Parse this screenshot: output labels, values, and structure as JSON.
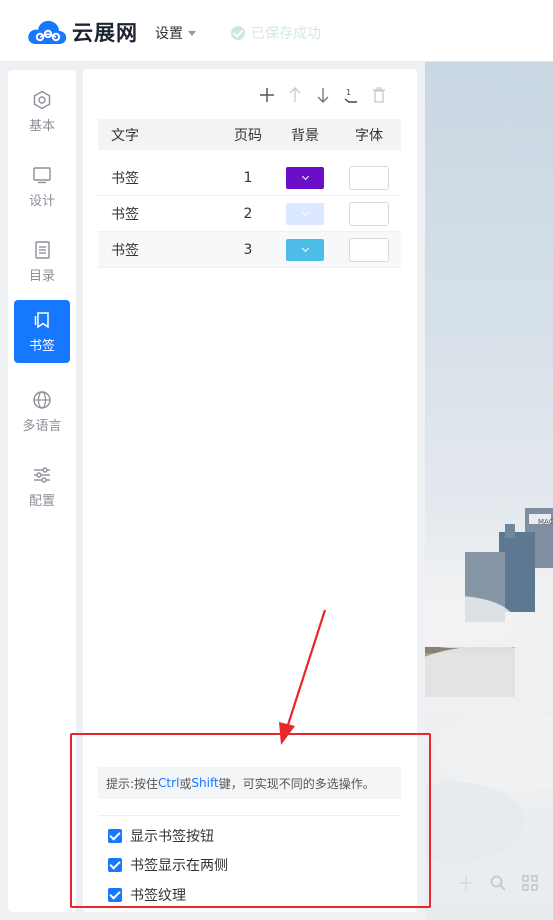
{
  "header": {
    "brand": "云展网",
    "settings_label": "设置",
    "save_status": "已保存成功"
  },
  "sidebar": {
    "items": [
      {
        "label": "基本",
        "icon": "hexagon-settings-icon"
      },
      {
        "label": "设计",
        "icon": "monitor-icon"
      },
      {
        "label": "目录",
        "icon": "document-list-icon"
      },
      {
        "label": "书签",
        "icon": "bookmark-icon",
        "active": true
      },
      {
        "label": "多语言",
        "icon": "globe-icon"
      },
      {
        "label": "配置",
        "icon": "sliders-icon"
      }
    ]
  },
  "toolbar": {
    "icons": [
      "add-icon",
      "move-up-icon",
      "move-down-icon",
      "sort-icon",
      "delete-icon"
    ]
  },
  "table": {
    "headers": {
      "text": "文字",
      "page": "页码",
      "bg": "背景",
      "font": "字体"
    },
    "rows": [
      {
        "text": "书签",
        "page": "1",
        "bg_color": "#6a0fc9"
      },
      {
        "text": "书签",
        "page": "2",
        "bg_color": "#dce8ff"
      },
      {
        "text": "书签",
        "page": "3",
        "bg_color": "#4cbde6"
      }
    ]
  },
  "hint": {
    "prefix": "提示:按住 ",
    "key1": "Ctrl",
    "mid": " 或 ",
    "key2": "Shift",
    "suffix": " 键，可实现不同的多选操作。"
  },
  "options": [
    {
      "label": "显示书签按钮",
      "checked": true
    },
    {
      "label": "书签显示在两侧",
      "checked": true
    },
    {
      "label": "书签纹理",
      "checked": true
    }
  ],
  "preview": {
    "building_sign": "MAC",
    "tools": [
      "plus-icon",
      "zoom-icon",
      "grid-icon"
    ]
  },
  "colors": {
    "accent": "#1677ff",
    "annotation": "#e8262b"
  }
}
